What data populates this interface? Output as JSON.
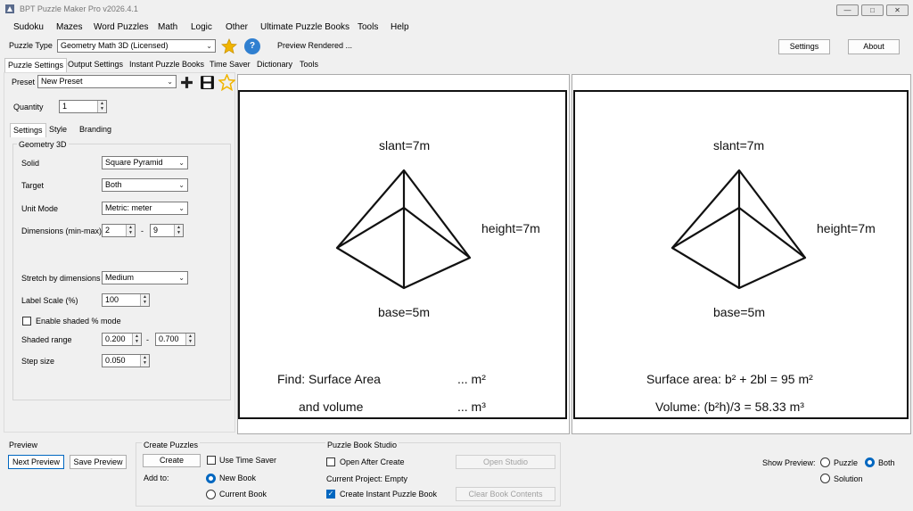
{
  "window": {
    "title": "BPT Puzzle Maker Pro v2026.4.1"
  },
  "menu": [
    "Sudoku",
    "Mazes",
    "Word Puzzles",
    "Math",
    "Logic",
    "Other",
    "Ultimate Puzzle Books",
    "Tools",
    "Help"
  ],
  "toolbar": {
    "puzzle_type_label": "Puzzle Type",
    "puzzle_type_value": "Geometry Math 3D (Licensed)",
    "help_glyph": "?",
    "status": "Preview Rendered ...",
    "settings_label": "Settings",
    "about_label": "About"
  },
  "main_tabs": [
    "Puzzle Settings",
    "Output Settings",
    "Instant Puzzle Books",
    "Time Saver",
    "Dictionary",
    "Tools"
  ],
  "preset": {
    "label": "Preset",
    "value": "New Preset"
  },
  "quantity": {
    "label": "Quantity",
    "value": "1"
  },
  "sub_tabs": [
    "Settings",
    "Style",
    "Branding"
  ],
  "group_title": "Geometry 3D",
  "fields": {
    "solid": {
      "label": "Solid",
      "value": "Square Pyramid"
    },
    "target": {
      "label": "Target",
      "value": "Both"
    },
    "unit_mode": {
      "label": "Unit Mode",
      "value": "Metric: meter"
    },
    "dimensions": {
      "label": "Dimensions (min-max)",
      "min": "2",
      "dash": "-",
      "max": "9"
    },
    "stretch": {
      "label": "Stretch by dimensions",
      "value": "Medium"
    },
    "label_scale": {
      "label": "Label Scale (%)",
      "value": "100"
    },
    "shaded_mode": {
      "label": "Enable shaded % mode",
      "checked": false
    },
    "shaded_range": {
      "label": "Shaded range",
      "min": "0.200",
      "dash": "-",
      "max": "0.700"
    },
    "step_size": {
      "label": "Step size",
      "value": "0.050"
    }
  },
  "puzzle_card": {
    "slant": "slant=7m",
    "height": "height=7m",
    "base": "base=5m",
    "line1_left": "Find: Surface Area",
    "line1_right": "... m²",
    "line2_left": "and volume",
    "line2_right": "... m³"
  },
  "solution_card": {
    "slant": "slant=7m",
    "height": "height=7m",
    "base": "base=5m",
    "surface": "Surface area: b² + 2bl = 95 m²",
    "volume": "Volume: (b²h)/3 = 58.33 m³"
  },
  "bottom": {
    "preview_title": "Preview",
    "next_preview": "Next Preview",
    "save_preview": "Save Preview",
    "create_title": "Create Puzzles",
    "create_btn": "Create",
    "use_time_saver": "Use Time Saver",
    "add_to": "Add to:",
    "new_book": "New Book",
    "current_book": "Current Book",
    "studio_title": "Puzzle Book Studio",
    "open_after_create": "Open After Create",
    "open_studio": "Open Studio",
    "current_project": "Current Project: Empty",
    "create_instant": "Create Instant Puzzle Book",
    "clear_book": "Clear Book Contents",
    "show_preview": "Show Preview:",
    "opt_puzzle": "Puzzle",
    "opt_both": "Both",
    "opt_solution": "Solution"
  },
  "colors": {
    "accent": "#0067c0",
    "star": "#f0b400",
    "help": "#2f7fd0"
  }
}
